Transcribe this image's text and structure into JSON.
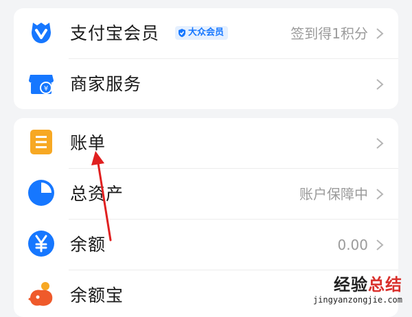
{
  "card_top": {
    "items": [
      {
        "label": "支付宝会员",
        "badge": "大众会员",
        "right": "签到得1积分",
        "icon": "alipay-member-icon"
      },
      {
        "label": "商家服务",
        "right": "",
        "icon": "merchant-store-icon"
      }
    ]
  },
  "card_main": {
    "items": [
      {
        "label": "账单",
        "right": "",
        "icon": "bill-icon"
      },
      {
        "label": "总资产",
        "right": "账户保障中",
        "icon": "pie-chart-icon"
      },
      {
        "label": "余额",
        "right": "0.00",
        "icon": "yuan-coin-icon"
      },
      {
        "label": "余额宝",
        "right": "",
        "icon": "yuebao-icon"
      }
    ]
  },
  "watermark": {
    "cn_a": "经验",
    "cn_b": "总结",
    "url": "jingyanzongjie.com"
  },
  "colors": {
    "brand_blue": "#1677ff",
    "bill_orange": "#f7a823",
    "arrow_red": "#e02020"
  }
}
